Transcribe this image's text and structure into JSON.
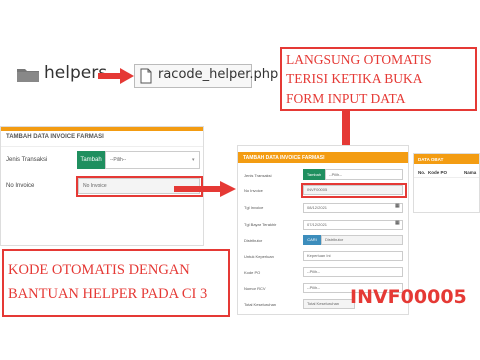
{
  "breadcrumb": {
    "folder_label": "helpers",
    "file_label": "racode_helper.php"
  },
  "callout_top": {
    "lines": [
      "LANGSUNG OTOMATIS",
      "TERISI KETIKA BUKA",
      "FORM INPUT DATA"
    ]
  },
  "form_left": {
    "title": "TAMBAH DATA INVOICE FARMASI",
    "jenis_label": "Jenis Transaksi",
    "tambah_button": "Tambah",
    "select_placeholder": "--Pilih--",
    "no_invoice_label": "No Invoice",
    "no_invoice_placeholder": "No Invoice"
  },
  "form_main": {
    "title": "TAMBAH DATA INVOICE FARMASI",
    "jenis_label": "Jenis Transaksi",
    "tambah_button": "Tambah",
    "select_placeholder": "--Pilih--",
    "no_invoice_label": "No Invoice",
    "no_invoice_value": "INVF00005",
    "tgl_invoice_label": "Tgl Invoice",
    "tgl_invoice_value": "08/12/2021",
    "tgl_bayar_label": "Tgl Bayar Terakhir",
    "tgl_bayar_value": "07/12/2021",
    "distributor_label": "Distributor",
    "cari_button": "CARI",
    "distributor_placeholder": "Distributor",
    "untuk_label": "Untuk Keperluan",
    "untuk_placeholder": "Keperluan Ini",
    "kode_po_label": "Kode PO",
    "kode_po_select": "--Pilih--",
    "nomor_rcv_label": "Nomor RCV",
    "nomor_rcv_select": "--Pilih--",
    "total_label": "Total Keseluruhan",
    "total_placeholder": "Total Keseluruhan"
  },
  "obat_panel": {
    "title": "DATA OBAT",
    "col_no": "No.",
    "col_kode_po": "Kode PO",
    "col_nama": "Nama"
  },
  "callout_bottom": {
    "lines": [
      "KODE OTOMATIS DENGAN",
      "BANTUAN HELPER PADA CI 3"
    ]
  },
  "invoice_code": "INVF00005",
  "colors": {
    "accent_red": "#e53935",
    "header_orange": "#f39c12",
    "button_green": "#1f8f5f",
    "button_blue": "#3c8dbc"
  },
  "icons": [
    "folder-icon",
    "file-icon",
    "calendar-icon",
    "arrow-icon"
  ]
}
